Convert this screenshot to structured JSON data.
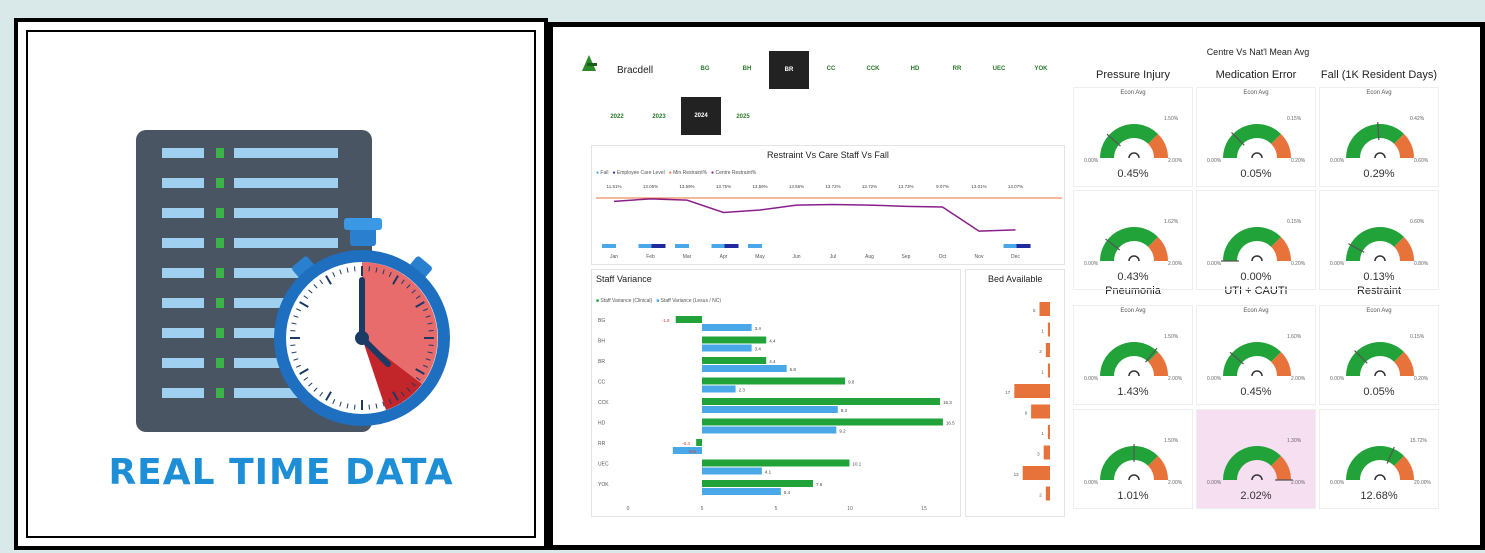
{
  "left": {
    "title": "REAL TIME DATA",
    "colors": {
      "title": "#1e8fd6",
      "server": "#4a5563",
      "slot": "#9fd0ef",
      "led": "#3bb34a",
      "clock_rim": "#1e6fbf",
      "clock_red": "#e03b3b"
    }
  },
  "dashboard": {
    "brand": "Bracdell",
    "sites": [
      "BG",
      "BH",
      "BR",
      "CC",
      "CCK",
      "HD",
      "RR",
      "UEC",
      "YOK"
    ],
    "active_site": "BR",
    "years": [
      "2022",
      "2023",
      "2024",
      "2025"
    ],
    "active_year": "2024",
    "restraint_chart": {
      "title": "Restraint Vs Care Staff Vs Fall",
      "legend": [
        "Fall",
        "Employee Care Level",
        "Min Restraint%",
        "Centre Restraint%"
      ],
      "months": [
        "Jan",
        "Feb",
        "Mar",
        "Apr",
        "May",
        "Jun",
        "Jul",
        "Aug",
        "Sep",
        "Oct",
        "Nov",
        "Dec"
      ],
      "line_labels": [
        "11.51%",
        "13.05%",
        "13.59%",
        "13.75%",
        "13.59%",
        "13.56%",
        "13.72%",
        "13.72%",
        "13.73%",
        "9.07%",
        "13.01%",
        "13.07%"
      ],
      "line_values": [
        13.2,
        13.6,
        13.4,
        11.4,
        11.8,
        12.6,
        12.7,
        12.6,
        12.4,
        12.3,
        8.4,
        8.6
      ],
      "fall_values": [
        2,
        1,
        2,
        1,
        2,
        0,
        0,
        0,
        0,
        0,
        0,
        1
      ],
      "fall2_values": [
        0,
        2,
        0,
        2,
        0,
        0,
        0,
        0,
        0,
        0,
        0,
        1
      ]
    },
    "staff_variance": {
      "title": "Staff Variance",
      "legend": [
        "Staff Variance (Clinical)",
        "Staff Variance (Lesus / NC)"
      ],
      "sites": [
        "BG",
        "BH",
        "BR",
        "CC",
        "CCK",
        "HD",
        "RR",
        "UEC",
        "YOK"
      ],
      "clinical": [
        -1.8,
        4.4,
        4.4,
        9.8,
        16.3,
        16.5,
        -0.4,
        10.1,
        7.6
      ],
      "nonclinical": [
        3.4,
        3.4,
        5.8,
        2.3,
        9.3,
        9.2,
        -2.0,
        4.1,
        5.4
      ],
      "clinical_labels": [
        "-1.8",
        "4.4",
        "4.4",
        "9.8",
        "16.3",
        "16.5",
        "-0.4",
        "10.1",
        "7.6"
      ],
      "nonclinical_labels": [
        "3.4",
        "3.4",
        "5.8",
        "2.3",
        "9.3",
        "9.2",
        "-0.8",
        "4.1",
        "5.4"
      ],
      "axis_ticks": [
        "0",
        "5",
        "5",
        "10",
        "15"
      ]
    },
    "bed_available": {
      "title": "Bed Available",
      "values": [
        5,
        1,
        2,
        1,
        17,
        9,
        1,
        3,
        13,
        2
      ],
      "labels": [
        "5",
        "1",
        "2",
        "1",
        "17",
        "9",
        "1",
        "3",
        "13",
        "2"
      ]
    },
    "gauges_header": "Centre Vs Nat'l Mean Avg",
    "gauge_groups_top": [
      "Pressure Injury",
      "Medication Error",
      "Fall (1K Resident Days)"
    ],
    "gauge_groups_bottom": [
      "Pneumonia",
      "UTI + CAUTI",
      "Restraint"
    ],
    "econ_label": "Econ Avg",
    "gauges": [
      {
        "value": "0.45%",
        "target": "1.50%",
        "min": "0.00%",
        "max": "2.00%",
        "fill": 0.23
      },
      {
        "value": "0.05%",
        "target": "0.15%",
        "min": "0.00%",
        "max": "0.20%",
        "fill": 0.25
      },
      {
        "value": "0.29%",
        "target": "0.42%",
        "min": "0.00%",
        "max": "0.60%",
        "fill": 0.48
      },
      {
        "value": "0.43%",
        "target": "1.62%",
        "min": "0.00%",
        "max": "2.00%",
        "fill": 0.21
      },
      {
        "value": "0.00%",
        "target": "0.15%",
        "min": "0.00%",
        "max": "0.20%",
        "fill": 0.0
      },
      {
        "value": "0.13%",
        "target": "0.60%",
        "min": "0.00%",
        "max": "0.80%",
        "fill": 0.16
      },
      {
        "value": "1.43%",
        "target": "1.50%",
        "min": "0.00%",
        "max": "2.00%",
        "fill": 0.72
      },
      {
        "value": "0.45%",
        "target": "1.60%",
        "min": "0.00%",
        "max": "2.00%",
        "fill": 0.23
      },
      {
        "value": "0.05%",
        "target": "0.15%",
        "min": "0.00%",
        "max": "0.20%",
        "fill": 0.25
      },
      {
        "value": "1.01%",
        "target": "1.50%",
        "min": "0.00%",
        "max": "2.00%",
        "fill": 0.5
      },
      {
        "value": "2.02%",
        "target": "1.30%",
        "min": "0.00%",
        "max": "2.00%",
        "fill": 1.0
      },
      {
        "value": "12.68%",
        "target": "15.72%",
        "min": "0.00%",
        "max": "20.00%",
        "fill": 0.63
      }
    ],
    "colors": {
      "green": "#22a33a",
      "orange": "#e8733a",
      "blue": "#4aa8e8",
      "navy": "#1f2a9e",
      "purple": "#8a1f8a",
      "pink": "#f7dff2"
    }
  }
}
